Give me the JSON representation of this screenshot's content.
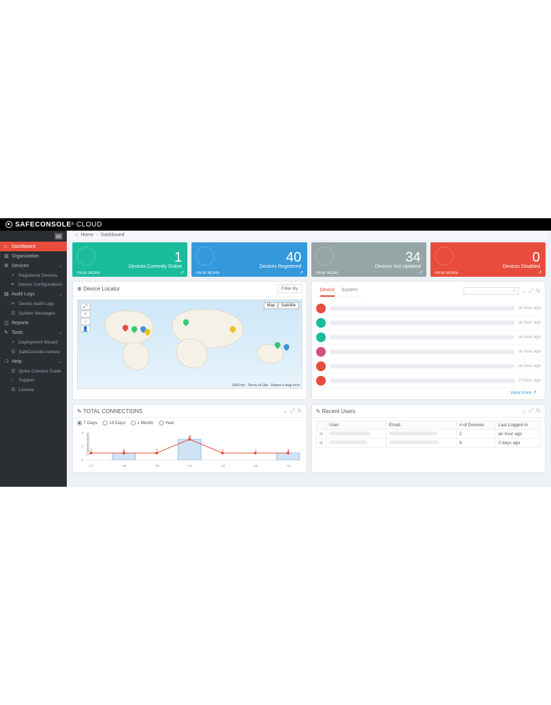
{
  "brand": {
    "name": "SAFECONSOLE",
    "suffix": "CLOUD"
  },
  "breadcrumb": {
    "home": "Home",
    "page": "Dashboard"
  },
  "sidebar": {
    "items": [
      {
        "label": "Dashboard",
        "icon": "⌂",
        "active": true
      },
      {
        "label": "Organization",
        "icon": "▤"
      },
      {
        "label": "Devices",
        "icon": "⚙",
        "expandable": true
      },
      {
        "label": "Registered Devices",
        "icon": "✓",
        "sub": true
      },
      {
        "label": "Device Configurations",
        "icon": "≡",
        "sub": true
      },
      {
        "label": "Audit Logs",
        "icon": "▤",
        "expandable": true
      },
      {
        "label": "Device Audit Logs",
        "icon": "✂",
        "sub": true
      },
      {
        "label": "System Messages",
        "icon": "☰",
        "sub": true
      },
      {
        "label": "Reports",
        "icon": "◫"
      },
      {
        "label": "Tools",
        "icon": "✎",
        "expandable": true
      },
      {
        "label": "Deployment Wizard",
        "icon": "✓",
        "sub": true
      },
      {
        "label": "SafeConsole Admins",
        "icon": "☰",
        "sub": true
      },
      {
        "label": "Help",
        "icon": "❍",
        "expandable": true
      },
      {
        "label": "Quick Connect Guide",
        "icon": "☰",
        "sub": true
      },
      {
        "label": "Support",
        "icon": "○",
        "sub": true
      },
      {
        "label": "License",
        "icon": "☰",
        "sub": true
      }
    ]
  },
  "cards": [
    {
      "value": "1",
      "label": "Devices Currently Online",
      "view": "VIEW MORE",
      "color": "green"
    },
    {
      "value": "40",
      "label": "Devices Registered",
      "view": "VIEW MORE",
      "color": "blue"
    },
    {
      "value": "34",
      "label": "Devices Not Updated",
      "view": "VIEW MORE",
      "color": "grey"
    },
    {
      "value": "0",
      "label": "Devices Disabled",
      "view": "VIEW MORE",
      "color": "red"
    }
  ],
  "locator": {
    "title": "Device Locator",
    "filter": "Filter By",
    "map_buttons": {
      "map": "Map",
      "sat": "Satellite"
    },
    "footer": {
      "scale": "1000 km",
      "terms": "Terms of Use",
      "report": "Report a map error"
    }
  },
  "activity": {
    "tabs": {
      "device": "Device",
      "system": "System"
    },
    "feed_times": [
      "an hour ago",
      "an hour ago",
      "an hour ago",
      "an hour ago",
      "an hour ago",
      "2 hours ago"
    ],
    "viewmore": "View more"
  },
  "connections": {
    "title": "TOTAL CONNECTIONS",
    "ranges": {
      "d7": "7 Days",
      "d14": "14 Days",
      "m1": "1 Month",
      "yr": "Year"
    },
    "ylabel": "Connections"
  },
  "chart_data": {
    "type": "bar",
    "categories": [
      "-17",
      "-16",
      "-15",
      "-14",
      "-13",
      "-12",
      "-11"
    ],
    "series": [
      {
        "name": "bar",
        "values": [
          0,
          1,
          0,
          3,
          0,
          0,
          1
        ]
      },
      {
        "name": "flag",
        "values": [
          -1,
          -1,
          -1,
          -3,
          -1,
          -1,
          -1
        ]
      }
    ],
    "ylim": [
      0,
      4
    ],
    "ylabel": "Connections"
  },
  "recent": {
    "title": "Recent Users",
    "cols": {
      "user": "User",
      "email": "Email",
      "devices": "# of Devices",
      "last": "Last Logged In"
    },
    "rows": [
      {
        "devices": "2",
        "last": "an hour ago"
      },
      {
        "devices": "6",
        "last": "3 days ago"
      }
    ]
  }
}
